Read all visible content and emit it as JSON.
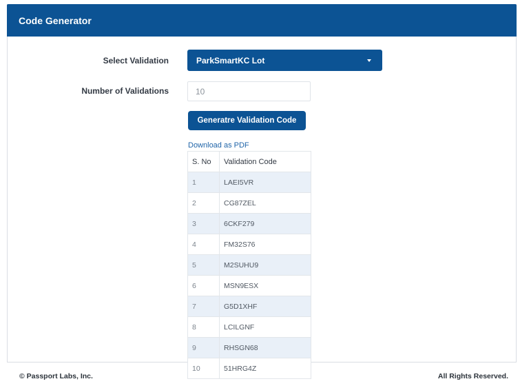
{
  "header": {
    "title": "Code Generator"
  },
  "form": {
    "select_label": "Select Validation",
    "select_value": "ParkSmartKC Lot",
    "number_label": "Number of Validations",
    "number_value": "10",
    "generate_label": "Generatre Validation Code",
    "download_label": "Download as PDF"
  },
  "table": {
    "headers": [
      "S. No",
      "Validation Code"
    ],
    "rows": [
      [
        "1",
        "LAEI5VR"
      ],
      [
        "2",
        "CG87ZEL"
      ],
      [
        "3",
        "6CKF279"
      ],
      [
        "4",
        "FM32S76"
      ],
      [
        "5",
        "M2SUHU9"
      ],
      [
        "6",
        "MSN9ESX"
      ],
      [
        "7",
        "G5D1XHF"
      ],
      [
        "8",
        "LCILGNF"
      ],
      [
        "9",
        "RHSGN68"
      ],
      [
        "10",
        "51HRG4Z"
      ]
    ]
  },
  "footer": {
    "left": "© Passport Labs, Inc.",
    "right": "All Rights Reserved."
  },
  "colors": {
    "brand": "#0c5394",
    "stripe": "#e9f0f8"
  }
}
